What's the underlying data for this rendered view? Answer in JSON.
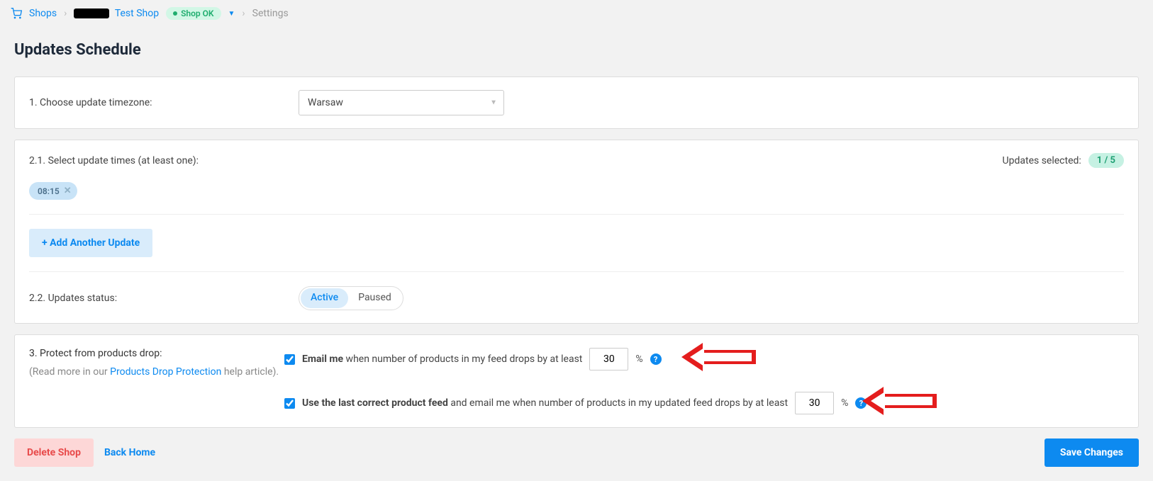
{
  "breadcrumb": {
    "shops": "Shops",
    "test_shop": "Test Shop",
    "status_badge": "Shop OK",
    "settings": "Settings"
  },
  "page_title": "Updates Schedule",
  "section1": {
    "label": "1. Choose update timezone:",
    "value": "Warsaw"
  },
  "section2_1": {
    "label": "2.1. Select update times (at least one):",
    "updates_selected_label": "Updates selected:",
    "count_text": "1 / 5",
    "chips": [
      {
        "time": "08:15"
      }
    ],
    "add_button": "+ Add Another Update"
  },
  "section2_2": {
    "label": "2.2. Updates status:",
    "options": {
      "active": "Active",
      "paused": "Paused"
    },
    "selected": "Active"
  },
  "section3": {
    "label": "3. Protect from products drop:",
    "subtext_prefix": "(Read more in our ",
    "subtext_link": "Products Drop Protection",
    "subtext_suffix": " help article).",
    "email_me": {
      "checked": true,
      "bold": "Email me",
      "rest": " when number of products in my feed drops by at least",
      "value": "30",
      "pct": "%"
    },
    "use_last": {
      "checked": true,
      "bold": "Use the last correct product feed",
      "rest": " and email me when number of products in my updated feed drops by at least",
      "value": "30",
      "pct": "%"
    }
  },
  "footer": {
    "delete": "Delete Shop",
    "back": "Back Home",
    "save": "Save Changes"
  }
}
